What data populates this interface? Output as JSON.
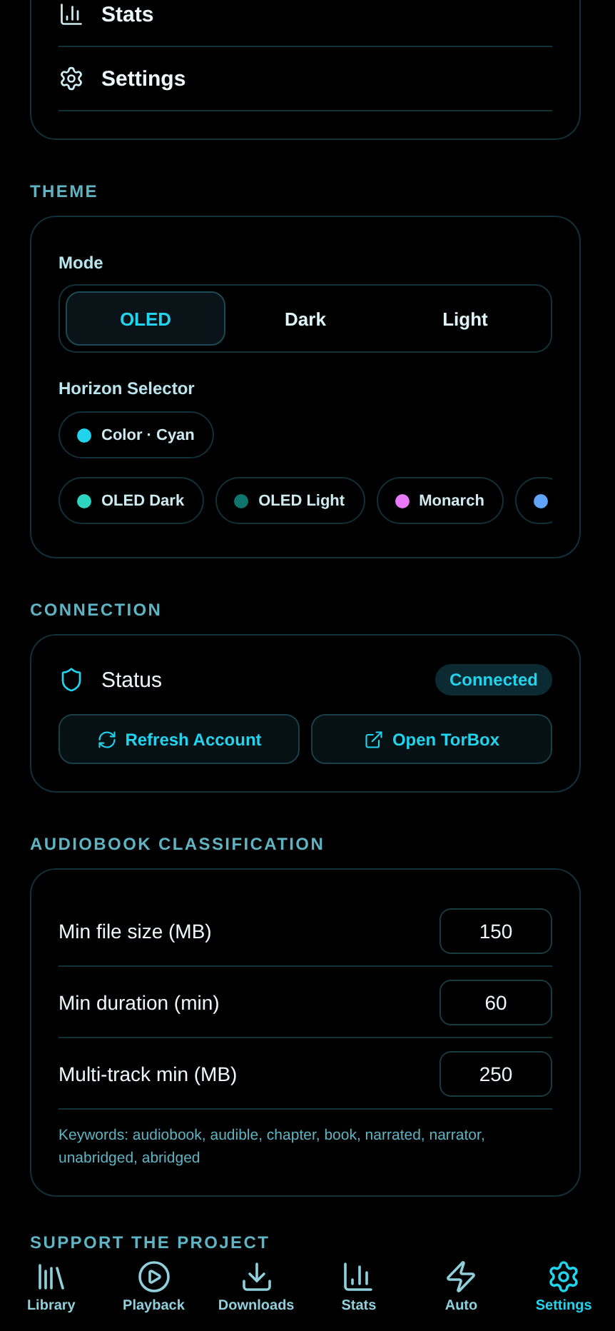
{
  "menu": [
    {
      "label": "Stats"
    },
    {
      "label": "Settings"
    }
  ],
  "theme": {
    "heading": "THEME",
    "mode_label": "Mode",
    "modes": [
      {
        "label": "OLED",
        "selected": true
      },
      {
        "label": "Dark",
        "selected": false
      },
      {
        "label": "Light",
        "selected": false
      }
    ],
    "horizon_label": "Horizon Selector",
    "color_chip": {
      "label": "Color · Cyan",
      "color": "#22d3ee"
    },
    "presets": [
      {
        "label": "OLED Dark",
        "color": "#2dd4bf"
      },
      {
        "label": "OLED Light",
        "color": "#0f766e"
      },
      {
        "label": "Monarch",
        "color": "#e879f9"
      },
      {
        "color": "#60a5fa"
      }
    ]
  },
  "connection": {
    "heading": "CONNECTION",
    "status_label": "Status",
    "status": "Connected",
    "buttons": [
      {
        "label": "Refresh Account"
      },
      {
        "label": "Open TorBox"
      }
    ]
  },
  "classification": {
    "heading": "AUDIOBOOK CLASSIFICATION",
    "fields": [
      {
        "label": "Min file size (MB)",
        "value": "150"
      },
      {
        "label": "Min duration (min)",
        "value": "60"
      },
      {
        "label": "Multi-track min (MB)",
        "value": "250"
      }
    ],
    "keywords": "Keywords: audiobook, audible, chapter, book, narrated, narrator, unabridged, abridged"
  },
  "next_heading": "SUPPORT THE PROJECT",
  "nav": [
    {
      "label": "Library",
      "selected": false
    },
    {
      "label": "Playback",
      "selected": false
    },
    {
      "label": "Downloads",
      "selected": false
    },
    {
      "label": "Stats",
      "selected": false
    },
    {
      "label": "Auto",
      "selected": false
    },
    {
      "label": "Settings",
      "selected": true
    }
  ]
}
